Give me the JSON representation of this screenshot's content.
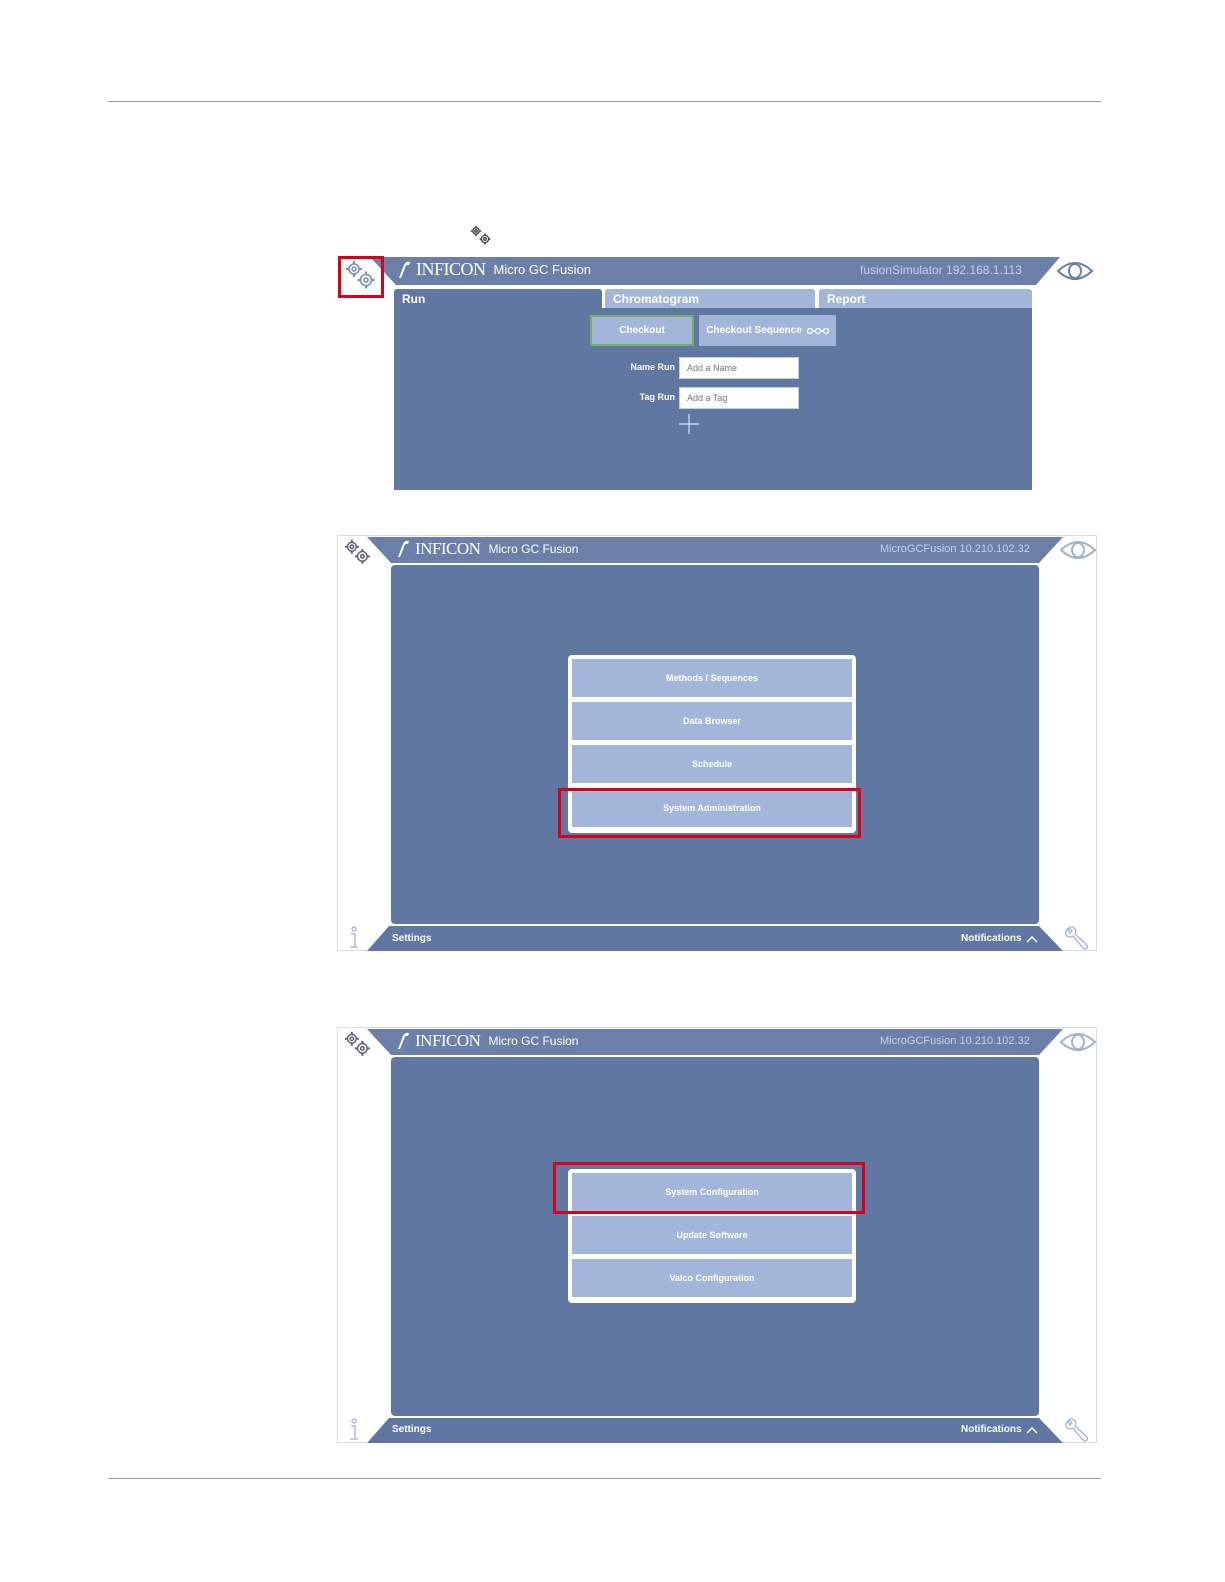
{
  "brand": {
    "name": "INFICON",
    "product": "Micro GC Fusion"
  },
  "screen1": {
    "host": "fusionSimulator 192.168.1.113",
    "tabs": [
      {
        "label": "Run"
      },
      {
        "label": "Chromatogram"
      },
      {
        "label": "Report"
      }
    ],
    "buttons": {
      "checkout": "Checkout",
      "checkout_sequence": "Checkout Sequence"
    },
    "fields": {
      "name_label": "Name Run",
      "name_placeholder": "Add a Name",
      "tag_label": "Tag Run",
      "tag_placeholder": "Add a Tag"
    }
  },
  "screen2": {
    "host": "MicroGCFusion 10.210.102.32",
    "menu": [
      {
        "label": "Methods / Sequences"
      },
      {
        "label": "Data Browser"
      },
      {
        "label": "Schedule"
      },
      {
        "label": "System Administration"
      }
    ],
    "footer": {
      "settings": "Settings",
      "notifications": "Notifications"
    }
  },
  "screen3": {
    "host": "MicroGCFusion 10.210.102.32",
    "menu": [
      {
        "label": "System Configuration"
      },
      {
        "label": "Update Software"
      },
      {
        "label": "Valco Configuration"
      }
    ],
    "footer": {
      "settings": "Settings",
      "notifications": "Notifications"
    }
  },
  "colors": {
    "header": "#6b7fa8",
    "panel": "#6077a1",
    "button": "#a3b6da",
    "highlight": "#d9001b",
    "checkout_border": "#6fae6f"
  },
  "icons": [
    "gear-icon",
    "eye-icon",
    "inficon-logo-icon",
    "sequence-icon",
    "plus-icon",
    "info-icon",
    "wrench-icon",
    "chevron-up-icon"
  ]
}
